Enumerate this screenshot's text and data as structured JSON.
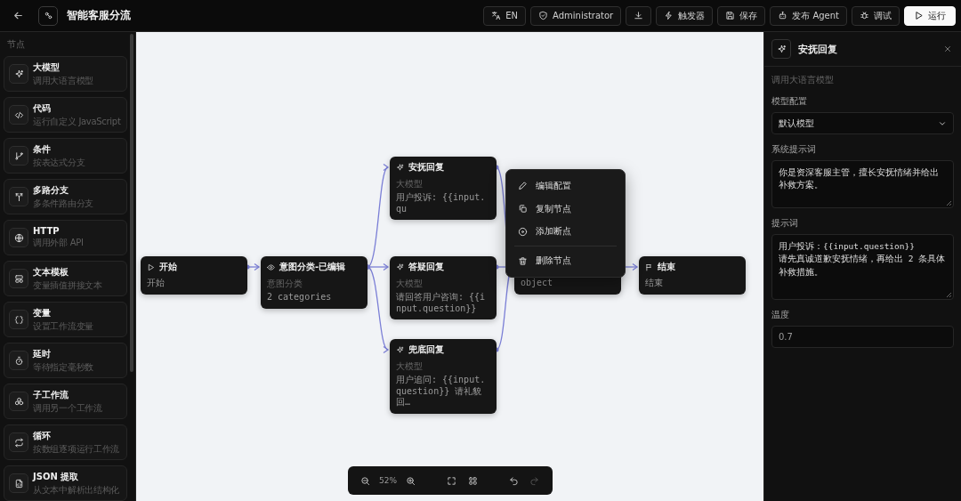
{
  "app": {
    "title": "智能客服分流"
  },
  "toolbar": [
    {
      "kind": "language",
      "label": "EN"
    },
    {
      "kind": "role",
      "label": "Administrator"
    },
    {
      "kind": "download"
    },
    {
      "kind": "triggers",
      "label": "触发器"
    },
    {
      "kind": "save",
      "label": "保存"
    },
    {
      "kind": "publish",
      "label": "发布 Agent"
    },
    {
      "kind": "debug",
      "label": "调试"
    },
    {
      "kind": "run",
      "label": "运行"
    }
  ],
  "palette": {
    "heading": "节点",
    "items": [
      {
        "kind": "llm",
        "title": "大模型",
        "description": "调用大语言模型"
      },
      {
        "kind": "code",
        "title": "代码",
        "description": "运行自定义 JavaScript"
      },
      {
        "kind": "condition",
        "title": "条件",
        "description": "按表达式分支"
      },
      {
        "kind": "switch",
        "title": "多路分支",
        "description": "多条件路由分支"
      },
      {
        "kind": "http",
        "title": "HTTP",
        "description": "调用外部 API"
      },
      {
        "kind": "template",
        "title": "文本模板",
        "description": "变量插值拼接文本"
      },
      {
        "kind": "variable",
        "title": "变量",
        "description": "设置工作流变量"
      },
      {
        "kind": "delay",
        "title": "延时",
        "description": "等待指定毫秒数"
      },
      {
        "kind": "subflow",
        "title": "子工作流",
        "description": "调用另一个工作流"
      },
      {
        "kind": "loop",
        "title": "循环",
        "description": "按数组逐项运行工作流"
      },
      {
        "kind": "json",
        "title": "JSON 提取",
        "description": "从文本中解析出结构化"
      }
    ]
  },
  "canvas": {
    "nodes": [
      {
        "kind": "start",
        "title": "开始",
        "detail": "开始"
      },
      {
        "kind": "classifier",
        "title": "意图分类-已编辑",
        "type_label": "意图分类",
        "detail": "2 categories"
      },
      {
        "kind": "llm",
        "title": "安抚回复",
        "type_label": "大模型",
        "detail": "用户投诉: {{input.qu"
      },
      {
        "kind": "llm",
        "title": "答疑回复",
        "type_label": "大模型",
        "detail": "请回答用户咨询: {{input.question}}"
      },
      {
        "kind": "covered",
        "detail": "object"
      },
      {
        "kind": "llm",
        "title": "兜底回复",
        "type_label": "大模型",
        "detail": "用户追问: {{input.question}} 请礼貌回…"
      },
      {
        "kind": "end",
        "title": "结束",
        "detail": "结束"
      }
    ],
    "context_menu": [
      {
        "kind": "edit",
        "label": "编辑配置"
      },
      {
        "kind": "copy",
        "label": "复制节点"
      },
      {
        "kind": "breakpoint",
        "label": "添加断点"
      },
      {
        "kind": "delete",
        "label": "删除节点"
      }
    ],
    "zoom_bar": {
      "zoom": "52%",
      "redo_disabled": true
    }
  },
  "panel": {
    "title": "安抚回复",
    "subtitle": "调用大语言模型",
    "fields": [
      {
        "kind": "select",
        "label": "模型配置",
        "value": "默认模型"
      },
      {
        "kind": "textarea",
        "label": "系统提示词",
        "value": "你是资深客服主管，擅长安抚情绪并给出补救方案。"
      },
      {
        "kind": "textarea",
        "label": "提示词",
        "value": "用户投诉：{{input.question}}\n请先真诚道歉安抚情绪，再给出 2 条具体补救措施。"
      },
      {
        "kind": "input",
        "label": "温度",
        "value": "0.7"
      }
    ]
  }
}
